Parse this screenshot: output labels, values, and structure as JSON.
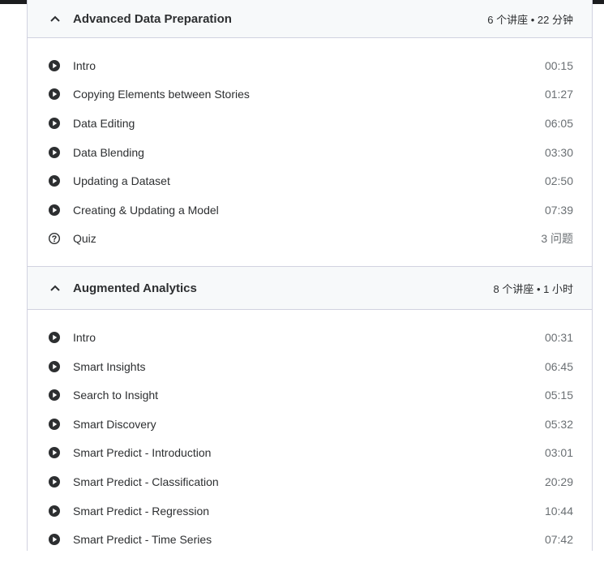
{
  "sections": [
    {
      "title": "Advanced Data Preparation",
      "meta": "6 个讲座 • 22 分钟",
      "items": [
        {
          "type": "video",
          "title": "Intro",
          "duration": "00:15"
        },
        {
          "type": "video",
          "title": "Copying Elements between Stories",
          "duration": "01:27"
        },
        {
          "type": "video",
          "title": "Data Editing",
          "duration": "06:05"
        },
        {
          "type": "video",
          "title": "Data Blending",
          "duration": "03:30"
        },
        {
          "type": "video",
          "title": "Updating a Dataset",
          "duration": "02:50"
        },
        {
          "type": "video",
          "title": "Creating & Updating a Model",
          "duration": "07:39"
        },
        {
          "type": "quiz",
          "title": "Quiz",
          "duration": "3 问题"
        }
      ]
    },
    {
      "title": "Augmented Analytics",
      "meta": "8 个讲座 • 1 小时",
      "items": [
        {
          "type": "video",
          "title": "Intro",
          "duration": "00:31"
        },
        {
          "type": "video",
          "title": "Smart Insights",
          "duration": "06:45"
        },
        {
          "type": "video",
          "title": "Search to Insight",
          "duration": "05:15"
        },
        {
          "type": "video",
          "title": "Smart Discovery",
          "duration": "05:32"
        },
        {
          "type": "video",
          "title": "Smart Predict - Introduction",
          "duration": "03:01"
        },
        {
          "type": "video",
          "title": "Smart Predict - Classification",
          "duration": "20:29"
        },
        {
          "type": "video",
          "title": "Smart Predict - Regression",
          "duration": "10:44"
        },
        {
          "type": "video",
          "title": "Smart Predict - Time Series",
          "duration": "07:42"
        }
      ]
    }
  ]
}
